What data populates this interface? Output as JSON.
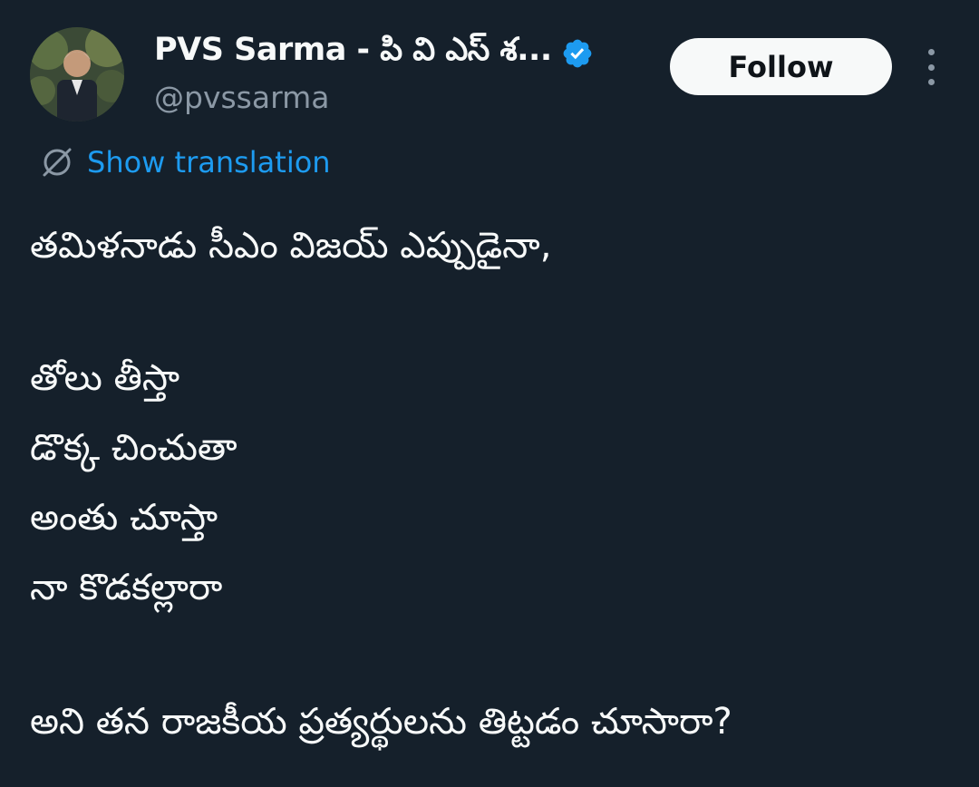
{
  "author": {
    "display_name": "PVS Sarma - పి వి ఎస్ శ...",
    "handle": "@pvssarma",
    "verified": true,
    "avatar_icon": "profile-photo",
    "verified_icon": "verified-badge-icon"
  },
  "actions": {
    "follow_label": "Follow",
    "more_icon": "more-options-icon"
  },
  "translation": {
    "label": "Show translation",
    "icon": "translate-globe-icon"
  },
  "tweet": {
    "lines": [
      "తమిళనాడు సీఎం విజయ్ ఎప్పుడైనా,",
      "తోలు తీస్తా",
      "డొక్క చించుతా",
      "అంతు చూస్తా",
      "నా కొడకల్లారా",
      "అని తన రాజకీయ ప్రత్యర్థులను తిట్టడం చూసారా?"
    ]
  },
  "colors": {
    "background": "#15202b",
    "text": "#f7f9f9",
    "secondary_text": "#8b98a5",
    "link": "#1d9bf0",
    "verified": "#1d9bf0",
    "follow_bg": "#f7f9f9",
    "follow_text": "#0f1419"
  }
}
